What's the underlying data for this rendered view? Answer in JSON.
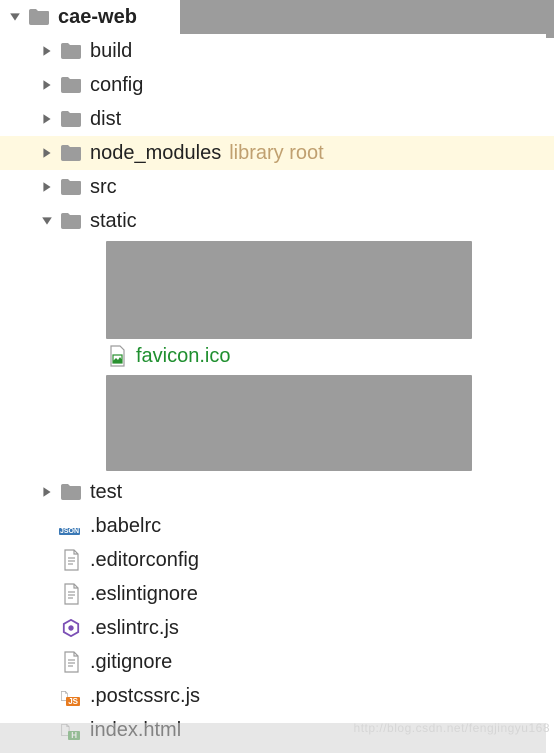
{
  "root": {
    "name": "cae-web"
  },
  "folders": {
    "build": "build",
    "config": "config",
    "dist": "dist",
    "node_modules": "node_modules",
    "node_modules_annotation": "library root",
    "src": "src",
    "static": "static",
    "test": "test"
  },
  "static_children": {
    "favicon": "favicon.ico"
  },
  "files": {
    "babelrc": ".babelrc",
    "editorconfig": ".editorconfig",
    "eslintignore": ".eslintignore",
    "eslintrc": ".eslintrc.js",
    "gitignore": ".gitignore",
    "postcssrc": ".postcssrc.js",
    "indexhtml": "index.html"
  },
  "watermark": "http://blog.csdn.net/fengjingyu168"
}
